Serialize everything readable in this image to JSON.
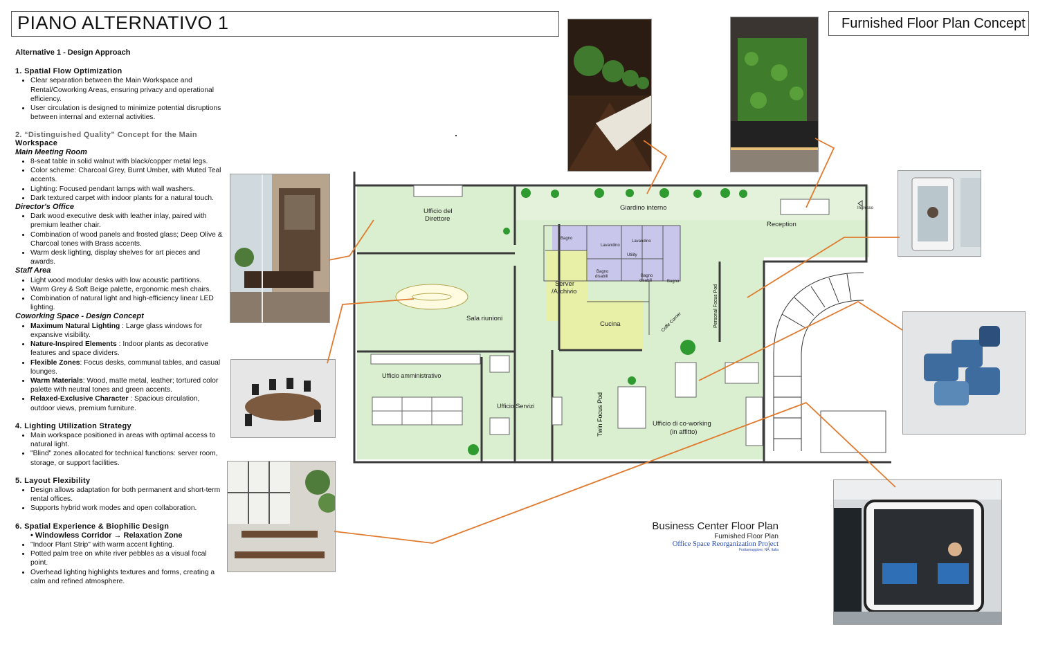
{
  "header": {
    "title": "PIANO ALTERNATIVO 1",
    "concept_title": "Furnished Floor Plan Concept"
  },
  "text": {
    "heading": "Alternative 1 - Design Approach",
    "s1_title": "1. Spatial Flow Optimization",
    "s1_items": [
      "Clear separation between the Main Workspace and Rental/Coworking Areas, ensuring privacy and operational efficiency.",
      "User circulation is designed to minimize potential disruptions between internal and external activities."
    ],
    "s2_title_a": "2. “Distinguished Quality” Concept for the Main",
    "s2_title_b": "Workspace",
    "meeting_title": "Main Meeting Room",
    "meeting_items": [
      "8-seat table in solid walnut with black/copper metal legs.",
      "Color scheme: Charcoal Grey, Burnt Umber, with Muted Teal accents.",
      "Lighting: Focused pendant lamps with wall washers.",
      "Dark textured carpet with indoor plants for a natural touch."
    ],
    "director_title": "Director's Office",
    "director_items": [
      "Dark wood executive desk with leather inlay, paired with premium leather chair.",
      "Combination of wood panels and frosted glass; Deep Olive & Charcoal tones with Brass accents.",
      "Warm desk lighting, display shelves for art pieces and awards."
    ],
    "staff_title": "Staff Area",
    "staff_items": [
      "Light wood modular desks with low acoustic partitions.",
      "Warm Grey & Soft Beige palette, ergonomic mesh chairs.",
      "Combination of natural light and high-efficiency linear LED lighting."
    ],
    "cowork_title": "Coworking Space - Design Concept",
    "cowork_items": [
      {
        "k": "Maximum Natural Lighting",
        "v": " : Large glass windows for expansive visibility."
      },
      {
        "k": "Nature-Inspired Elements",
        "v": " : Indoor plants as decorative features and space dividers."
      },
      {
        "k": "Flexible Zones",
        "v": ": Focus desks, communal tables, and casual lounges."
      },
      {
        "k": "Warm Materials",
        "v": ": Wood, matte metal, leather; tortured color palette with neutral tones and green accents."
      },
      {
        "k": "Relaxed-Exclusive Character",
        "v": " : Spacious circulation, outdoor views, premium furniture."
      }
    ],
    "s4_title": "4. Lighting Utilization Strategy",
    "s4_items": [
      "Main workspace positioned in areas with optimal access to natural light.",
      "\"Blind\" zones allocated for technical functions: server room, storage, or support facilities."
    ],
    "s5_title": "5. Layout Flexibility",
    "s5_items": [
      "Design allows adaptation for both permanent and short-term rental offices.",
      "Supports hybrid work modes and open collaboration."
    ],
    "s6_title": "6. Spatial Experience & Biophilic Design",
    "s6_sub": "Windowless Corridor → Relaxation Zone",
    "s6_items": [
      "\"Indoor Plant Strip\" with warm accent lighting.",
      "Potted palm tree on white river pebbles as a visual focal point.",
      "Overhead lighting highlights textures and forms, creating a calm and refined atmosphere."
    ]
  },
  "plan": {
    "director": "Ufficio del",
    "director_b": "Direttore",
    "garden": "Giardino interno",
    "reception": "Reception",
    "entrance": "Ingresso",
    "bagno": "Bagno",
    "lavandino": "Lavandino",
    "utility": "Utility",
    "bagno_disabili_a": "Bagno",
    "bagno_disabili_b": "disabili",
    "server_a": "Server",
    "server_b": "/Archivio",
    "meeting": "Sala riunioni",
    "kitchen": "Cucina",
    "coffee": "Coffe Corner",
    "personal_pod": "Personal Focus Pod",
    "admin": "Ufficio amministrativo",
    "services": "Ufficio Servizi",
    "twin_pod": "Twin Focus Pod",
    "cowork_a": "Ufficio di co-working",
    "cowork_b": "(in affitto)"
  },
  "legend": {
    "l1": "Business Center Floor Plan",
    "l2": "Furnished Floor Plan",
    "l3": "Office Space Reorganization Project",
    "l4": "Frattamaggiore, NA, Italia"
  },
  "colors": {
    "callout": "#e07a2e",
    "room_green": "#d9efcf",
    "bath_purple": "#c9c6ec",
    "server_yellow": "#e7f0a6",
    "wall": "#3a3a3a"
  }
}
